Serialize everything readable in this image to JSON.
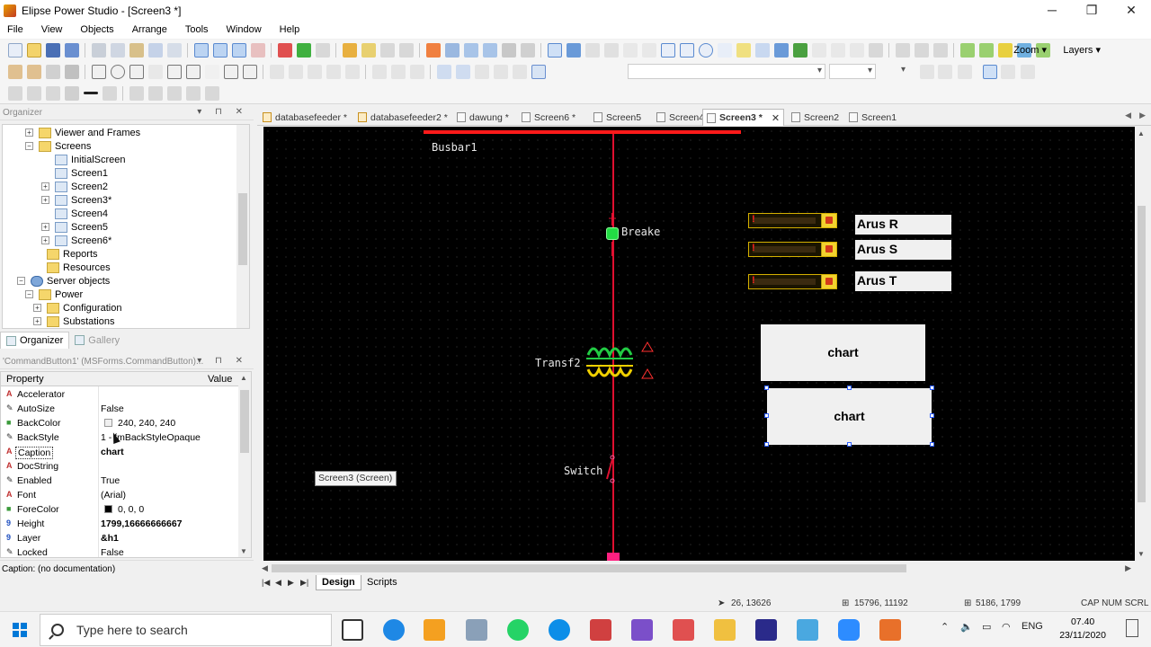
{
  "window": {
    "title": "Elipse Power Studio - [Screen3 *]",
    "minimize": "─",
    "restore": "❐",
    "close": "✕"
  },
  "menu": [
    "File",
    "View",
    "Objects",
    "Arrange",
    "Tools",
    "Window",
    "Help"
  ],
  "toolbar": {
    "zoom": "Zoom ▾",
    "layers": "Layers ▾"
  },
  "organizer": {
    "title": "Organizer",
    "controls": "▾ ⊓ ✕",
    "tree": [
      {
        "label": "Viewer and Frames",
        "indent": 3,
        "exp": "+",
        "icon": "folder"
      },
      {
        "label": "Screens",
        "indent": 3,
        "exp": "−",
        "icon": "folder"
      },
      {
        "label": "InitialScreen",
        "indent": 5,
        "exp": "",
        "icon": "screen"
      },
      {
        "label": "Screen1",
        "indent": 5,
        "exp": "",
        "icon": "screen"
      },
      {
        "label": "Screen2",
        "indent": 5,
        "exp": "+",
        "icon": "screen"
      },
      {
        "label": "Screen3*",
        "indent": 5,
        "exp": "+",
        "icon": "screen"
      },
      {
        "label": "Screen4",
        "indent": 5,
        "exp": "",
        "icon": "screen"
      },
      {
        "label": "Screen5",
        "indent": 5,
        "exp": "+",
        "icon": "screen"
      },
      {
        "label": "Screen6*",
        "indent": 5,
        "exp": "+",
        "icon": "screen"
      },
      {
        "label": "Reports",
        "indent": 4,
        "exp": "",
        "icon": "folder"
      },
      {
        "label": "Resources",
        "indent": 4,
        "exp": "",
        "icon": "folder"
      },
      {
        "label": "Server objects",
        "indent": 2,
        "exp": "−",
        "icon": "server"
      },
      {
        "label": "Power",
        "indent": 3,
        "exp": "−",
        "icon": "folder"
      },
      {
        "label": "Configuration",
        "indent": 4,
        "exp": "+",
        "icon": "folder"
      },
      {
        "label": "Substations",
        "indent": 4,
        "exp": "+",
        "icon": "folder"
      }
    ],
    "tab_organizer": "Organizer",
    "tab_gallery": "Gallery"
  },
  "properties": {
    "title": "'CommandButton1' (MSForms.CommandButton)...",
    "col_property": "Property",
    "col_value": "Value",
    "rows": [
      {
        "icon": "A",
        "name": "Accelerator",
        "value": ""
      },
      {
        "icon": "✎",
        "name": "AutoSize",
        "value": "False"
      },
      {
        "icon": "■",
        "name": "BackColor",
        "value": "240, 240, 240"
      },
      {
        "icon": "✎",
        "name": "BackStyle",
        "value": "1 - fmBackStyleOpaque"
      },
      {
        "icon": "A",
        "name": "Caption",
        "value": "chart"
      },
      {
        "icon": "A",
        "name": "DocString",
        "value": ""
      },
      {
        "icon": "✎",
        "name": "Enabled",
        "value": "True"
      },
      {
        "icon": "A",
        "name": "Font",
        "value": "(Arial)"
      },
      {
        "icon": "■",
        "name": "ForeColor",
        "value": "0, 0, 0"
      },
      {
        "icon": "9",
        "name": "Height",
        "value": "1799,16666666667"
      },
      {
        "icon": "9",
        "name": "Layer",
        "value": "&h1"
      },
      {
        "icon": "✎",
        "name": "Locked",
        "value": "False"
      }
    ],
    "doc": "Caption: (no documentation)"
  },
  "doc_tabs": [
    {
      "label": "databasefeeder *",
      "icon": "feeder"
    },
    {
      "label": "databasefeeder2 *",
      "icon": "feeder"
    },
    {
      "label": "dawung *",
      "icon": "screen"
    },
    {
      "label": "Screen6 *",
      "icon": "screen"
    },
    {
      "label": "Screen5",
      "icon": "screen"
    },
    {
      "label": "Screen4",
      "icon": "screen"
    },
    {
      "label": "Screen3 *",
      "icon": "screen",
      "active": true
    },
    {
      "label": "Screen2",
      "icon": "screen"
    },
    {
      "label": "Screen1",
      "icon": "screen"
    }
  ],
  "canvas": {
    "busbar_label": "Busbar1",
    "breaker_label": "Breake",
    "transformer_label": "Transf2",
    "switch_label": "Switch",
    "indicators": [
      "Arus R",
      "Arus S",
      "Arus T"
    ],
    "chart_button_1": "chart",
    "chart_button_2": "chart",
    "screen_tag": "Screen3 (Screen)",
    "colors": {
      "background": "#000000",
      "busbar": "#ff1a1a",
      "feeder": "#e01030",
      "breaker": "#22dd44",
      "transformer": "#f0d000",
      "selection": "#3060ff"
    }
  },
  "bottom_tabs": {
    "design": "Design",
    "scripts": "Scripts"
  },
  "status": {
    "cursor_pos": "26, 13626",
    "object_pos": "15796, 11192",
    "object_size": "5186, 1799",
    "indicators": "CAP  NUM  SCRL"
  },
  "taskbar": {
    "search_placeholder": "Type here to search",
    "language": "ENG",
    "time": "07.40",
    "date": "23/11/2020"
  }
}
